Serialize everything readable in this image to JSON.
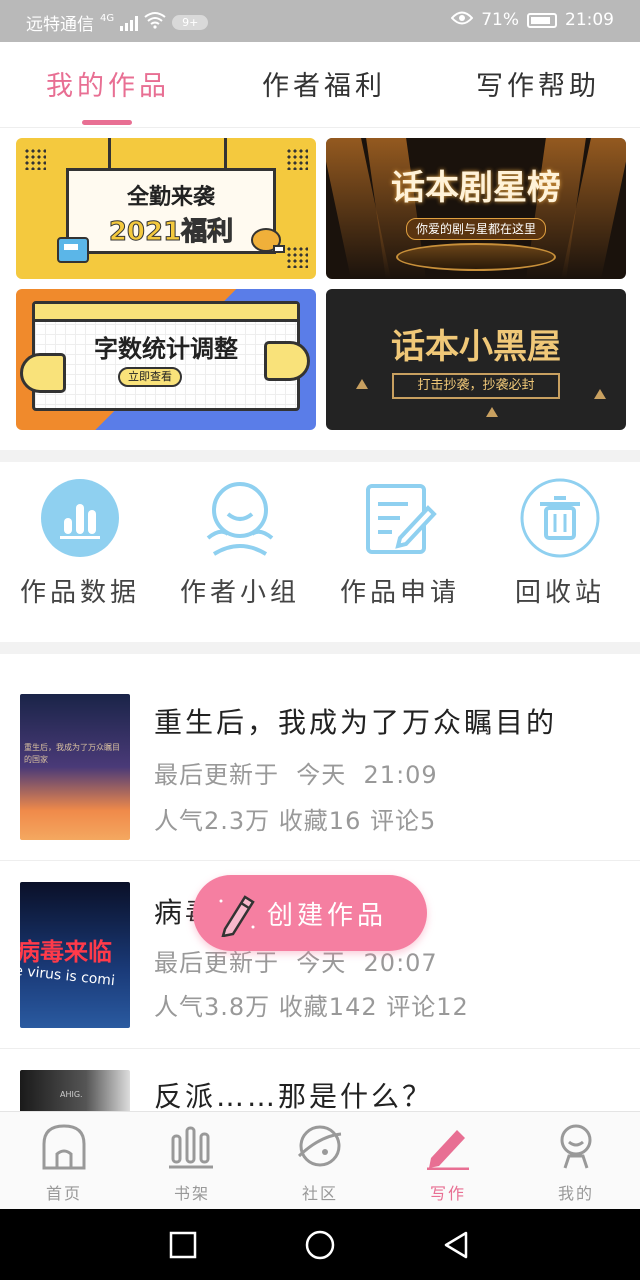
{
  "status_bar": {
    "carrier": "远特通信",
    "network": "4G",
    "notification_badge": "9+",
    "battery": "71%",
    "time": "21:09"
  },
  "tabs": [
    {
      "label": "我的作品",
      "active": true
    },
    {
      "label": "作者福利",
      "active": false
    },
    {
      "label": "写作帮助",
      "active": false
    }
  ],
  "banners": [
    {
      "line1": "全勤来袭",
      "line2": "2021福利"
    },
    {
      "title": "话本剧星榜",
      "subtitle": "你爱的剧与星都在这里"
    },
    {
      "title": "字数统计调整",
      "button": "立即查看"
    },
    {
      "title": "话本小黑屋",
      "subtitle": "打击抄袭，抄袭必封"
    }
  ],
  "quick_actions": [
    {
      "label": "作品数据",
      "icon": "bar-chart-icon"
    },
    {
      "label": "作者小组",
      "icon": "group-icon"
    },
    {
      "label": "作品申请",
      "icon": "edit-document-icon"
    },
    {
      "label": "回收站",
      "icon": "trash-icon"
    }
  ],
  "works": [
    {
      "title": "重生后，我成为了万众瞩目的",
      "updated_prefix": "最后更新于",
      "updated_day": "今天",
      "updated_time": "21:09",
      "stats": "人气2.3万 收藏16 评论5",
      "cover_text": "重生后，我成为了万众瞩目的国家"
    },
    {
      "title": "病毒来临",
      "updated_prefix": "最后更新于",
      "updated_day": "今天",
      "updated_time": "20:07",
      "stats": "人气3.8万 收藏142 评论12",
      "cover_text": "病毒来临",
      "cover_subtext": "e virus is comi"
    },
    {
      "title": "反派……那是什么？",
      "cover_text": "AHIG."
    }
  ],
  "create_button": {
    "label": "创建作品"
  },
  "bottom_nav": [
    {
      "label": "首页",
      "icon": "home-icon",
      "active": false
    },
    {
      "label": "书架",
      "icon": "bookshelf-icon",
      "active": false
    },
    {
      "label": "社区",
      "icon": "planet-icon",
      "active": false
    },
    {
      "label": "写作",
      "icon": "pen-icon",
      "active": true
    },
    {
      "label": "我的",
      "icon": "profile-icon",
      "active": false
    }
  ],
  "colors": {
    "accent": "#e86f93",
    "create_button": "#f57fa1",
    "quick_action_blue": "#8fd0f0"
  }
}
